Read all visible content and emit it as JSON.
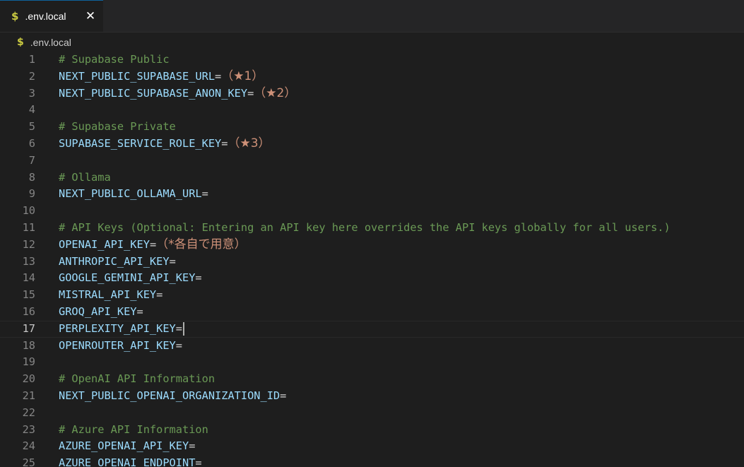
{
  "tab": {
    "icon": "$",
    "label": ".env.local",
    "close": "✕"
  },
  "breadcrumb": {
    "icon": "$",
    "label": ".env.local"
  },
  "editor": {
    "current_line": 17,
    "lines": [
      {
        "n": "1",
        "type": "comment",
        "text": "# Supabase Public"
      },
      {
        "n": "2",
        "type": "kv",
        "key": "NEXT_PUBLIC_SUPABASE_URL",
        "value": "（★1）"
      },
      {
        "n": "3",
        "type": "kv",
        "key": "NEXT_PUBLIC_SUPABASE_ANON_KEY",
        "value": "（★2）"
      },
      {
        "n": "4",
        "type": "blank"
      },
      {
        "n": "5",
        "type": "comment",
        "text": "# Supabase Private"
      },
      {
        "n": "6",
        "type": "kv",
        "key": "SUPABASE_SERVICE_ROLE_KEY",
        "value": "（★3）"
      },
      {
        "n": "7",
        "type": "blank"
      },
      {
        "n": "8",
        "type": "comment",
        "text": "# Ollama"
      },
      {
        "n": "9",
        "type": "kv",
        "key": "NEXT_PUBLIC_OLLAMA_URL",
        "value": ""
      },
      {
        "n": "10",
        "type": "blank"
      },
      {
        "n": "11",
        "type": "comment",
        "text": "# API Keys (Optional: Entering an API key here overrides the API keys globally for all users.)"
      },
      {
        "n": "12",
        "type": "kv",
        "key": "OPENAI_API_KEY",
        "value": "（*各自で用意）"
      },
      {
        "n": "13",
        "type": "kv",
        "key": "ANTHROPIC_API_KEY",
        "value": ""
      },
      {
        "n": "14",
        "type": "kv",
        "key": "GOOGLE_GEMINI_API_KEY",
        "value": ""
      },
      {
        "n": "15",
        "type": "kv",
        "key": "MISTRAL_API_KEY",
        "value": ""
      },
      {
        "n": "16",
        "type": "kv",
        "key": "GROQ_API_KEY",
        "value": ""
      },
      {
        "n": "17",
        "type": "kv",
        "key": "PERPLEXITY_API_KEY",
        "value": "",
        "cursor": true
      },
      {
        "n": "18",
        "type": "kv",
        "key": "OPENROUTER_API_KEY",
        "value": ""
      },
      {
        "n": "19",
        "type": "blank"
      },
      {
        "n": "20",
        "type": "comment",
        "text": "# OpenAI API Information"
      },
      {
        "n": "21",
        "type": "kv",
        "key": "NEXT_PUBLIC_OPENAI_ORGANIZATION_ID",
        "value": ""
      },
      {
        "n": "22",
        "type": "blank"
      },
      {
        "n": "23",
        "type": "comment",
        "text": "# Azure API Information"
      },
      {
        "n": "24",
        "type": "kv",
        "key": "AZURE_OPENAI_API_KEY",
        "value": ""
      },
      {
        "n": "25",
        "type": "kv",
        "key": "AZURE_OPENAI_ENDPOINT",
        "value": ""
      }
    ]
  },
  "colors": {
    "background": "#1e1e1e",
    "comment": "#6a9955",
    "key": "#9cdcfe",
    "value": "#ce9178",
    "line_number": "#858585",
    "file_icon": "#cbcb41"
  }
}
